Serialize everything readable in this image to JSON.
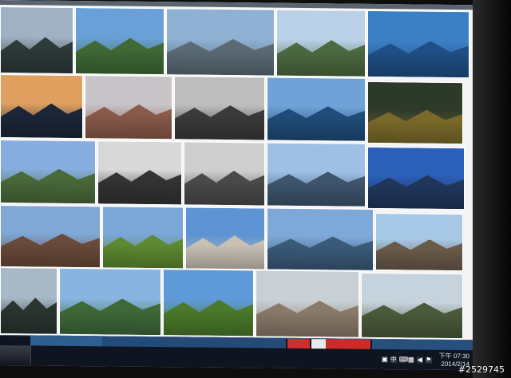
{
  "taskbar": {
    "clock_time": "下午 07:30",
    "clock_date": "2014/2/14",
    "tray_icons": [
      "input-method-icon",
      "chinese-input-icon",
      "keyboard-icon",
      "network-icon",
      "volume-icon",
      "flag-icon"
    ],
    "tray_glyphs": [
      "▣",
      "中",
      "⌨",
      "▦",
      "◀",
      "⚑"
    ]
  },
  "watermark": "#2529745",
  "thumbnails": [
    {
      "name": "fjord-valley-photo",
      "sky": "#9fb1c3",
      "land": "#2d3a3a"
    },
    {
      "name": "lone-tree-lake-photo",
      "sky": "#6aa0d8",
      "land": "#3f6a35"
    },
    {
      "name": "harbor-houses-photo",
      "sky": "#8fb2d4",
      "land": "#5b6b76"
    },
    {
      "name": "coastal-town-photo",
      "sky": "#b9d0e6",
      "land": "#4b6a40"
    },
    {
      "name": "snowy-peaks-lake-photo",
      "sky": "#3b7fc4",
      "land": "#1e4f86"
    },
    {
      "name": "sunset-fjord-photo",
      "sky": "#e0a060",
      "land": "#1c2638"
    },
    {
      "name": "pulpit-rock-photo",
      "sky": "#c8c4c8",
      "land": "#8a5a4a"
    },
    {
      "name": "bw-fjord-photo",
      "sky": "#bdbdbd",
      "land": "#3a3a3a"
    },
    {
      "name": "blue-fjord-cliff-photo",
      "sky": "#6fa2d6",
      "land": "#1f4c7a"
    },
    {
      "name": "autumn-valley-photo",
      "sky": "#2d3a2a",
      "land": "#7a6a2a"
    },
    {
      "name": "mountain-reflection-photo",
      "sky": "#87aee0",
      "land": "#4a6a3a"
    },
    {
      "name": "bw-waterfall-photo",
      "sky": "#d8d8d8",
      "land": "#333333"
    },
    {
      "name": "bw-lake-hills-photo",
      "sky": "#cfcfcf",
      "land": "#4a4a4a"
    },
    {
      "name": "person-on-rock-photo",
      "sky": "#9ec0e4",
      "land": "#3d556e"
    },
    {
      "name": "blue-sky-lake-photo",
      "sky": "#2a60b8",
      "land": "#20365a"
    },
    {
      "name": "village-shore-photo",
      "sky": "#7fa8d6",
      "land": "#6a4a3a"
    },
    {
      "name": "green-meadow-photo",
      "sky": "#7aa6d8",
      "land": "#5d8a30"
    },
    {
      "name": "stone-sculptures-photo",
      "sky": "#5e94d4",
      "land": "#c8c0b4"
    },
    {
      "name": "tree-lake-photo",
      "sky": "#7ea8d8",
      "land": "#3a5a7a"
    },
    {
      "name": "glacier-hiker-photo",
      "sky": "#a6c8e6",
      "land": "#6a5a4a"
    },
    {
      "name": "dark-mountain-photo",
      "sky": "#a7b9c6",
      "land": "#2a3530"
    },
    {
      "name": "green-cliff-fjord-photo",
      "sky": "#88b4e0",
      "land": "#3e6a3a"
    },
    {
      "name": "forest-garden-photo",
      "sky": "#5f9ad8",
      "land": "#4a7a2a"
    },
    {
      "name": "island-town-aerial-photo",
      "sky": "#c8d0d6",
      "land": "#8a7a6a"
    },
    {
      "name": "mountain-viewpoint-photo",
      "sky": "#c6d2dc",
      "land": "#4a5a3a"
    }
  ]
}
